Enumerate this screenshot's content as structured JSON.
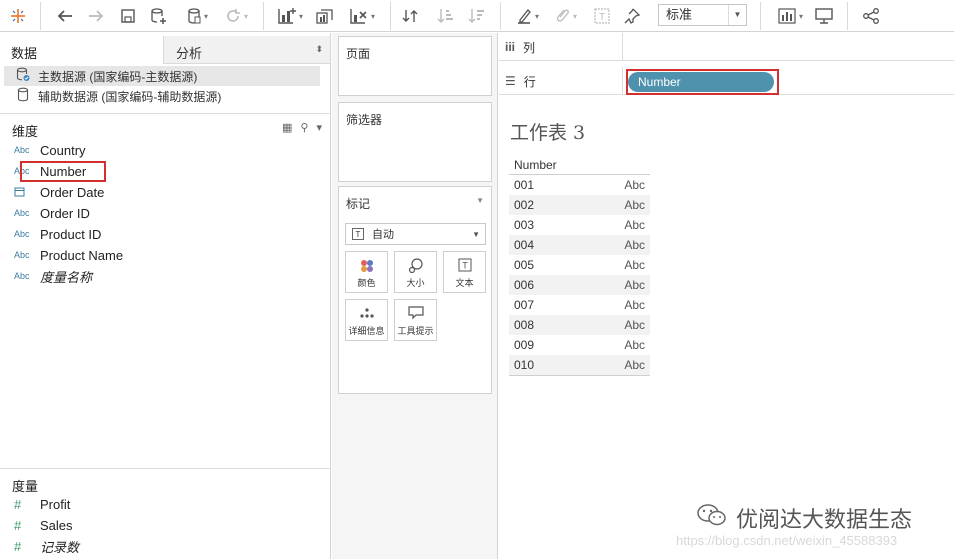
{
  "toolbar": {
    "icons": [
      "tableau-logo-icon",
      "back-icon",
      "forward-icon",
      "save-icon",
      "new-datasource-icon",
      "datasource-icon",
      "refresh-icon",
      "new-worksheet-icon",
      "duplicate-icon",
      "clear-icon",
      "swap-icon",
      "sort-asc-icon",
      "sort-desc-icon",
      "highlight-icon",
      "group-icon",
      "label-icon",
      "pin-icon",
      "chart-icon",
      "presentation-icon",
      "share-icon"
    ],
    "fit_select": "标准"
  },
  "left_panel": {
    "tab_data": "数据",
    "tab_analysis": "分析",
    "datasources": [
      {
        "label": "主数据源 (国家编码-主数据源)",
        "selected": true
      },
      {
        "label": "辅助数据源 (国家编码-辅助数据源)",
        "selected": false
      }
    ],
    "dimensions_title": "维度",
    "dimensions": [
      {
        "icon": "Abc",
        "name": "Country"
      },
      {
        "icon": "Abc",
        "name": "Number"
      },
      {
        "icon": "calendar",
        "name": "Order Date"
      },
      {
        "icon": "Abc",
        "name": "Order ID"
      },
      {
        "icon": "Abc",
        "name": "Product ID"
      },
      {
        "icon": "Abc",
        "name": "Product Name"
      },
      {
        "icon": "Abc",
        "name": "度量名称"
      }
    ],
    "measures_title": "度量",
    "measures": [
      {
        "icon": "#",
        "name": "Profit"
      },
      {
        "icon": "#",
        "name": "Sales"
      },
      {
        "icon": "#",
        "name": "记录数"
      }
    ]
  },
  "middle_panel": {
    "pages_title": "页面",
    "filters_title": "筛选器",
    "marks_title": "标记",
    "marks_type": "自动",
    "mark_buttons": [
      "颜色",
      "大小",
      "文本",
      "详细信息",
      "工具提示"
    ]
  },
  "shelves": {
    "columns_label": "列",
    "rows_label": "行",
    "rows_pill": "Number"
  },
  "worksheet": {
    "title": "工作表 3",
    "header": "Number",
    "rows": [
      {
        "key": "001",
        "val": "Abc"
      },
      {
        "key": "002",
        "val": "Abc"
      },
      {
        "key": "003",
        "val": "Abc"
      },
      {
        "key": "004",
        "val": "Abc"
      },
      {
        "key": "005",
        "val": "Abc"
      },
      {
        "key": "006",
        "val": "Abc"
      },
      {
        "key": "007",
        "val": "Abc"
      },
      {
        "key": "008",
        "val": "Abc"
      },
      {
        "key": "009",
        "val": "Abc"
      },
      {
        "key": "010",
        "val": "Abc"
      }
    ]
  },
  "watermark": {
    "text": "优阅达大数据生态",
    "url": "https://blog.csdn.net/weixin_45588393"
  },
  "colors": {
    "pill": "#4f92ad",
    "highlight_box": "#d32f2f"
  }
}
